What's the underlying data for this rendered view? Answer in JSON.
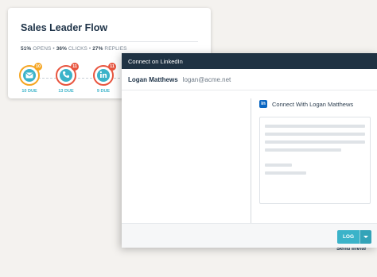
{
  "flow_card": {
    "title": "Sales Leader Flow",
    "stats": {
      "opens_value": "51%",
      "opens_label": "OPENS",
      "clicks_value": "36%",
      "clicks_label": "CLICKS",
      "replies_value": "27%",
      "replies_label": "REPLIES",
      "separator": "•"
    },
    "steps": [
      {
        "icon": "envelope-icon",
        "badge": "10",
        "due_label": "10 DUE"
      },
      {
        "icon": "phone-icon",
        "badge": "11",
        "due_label": "13 DUE"
      },
      {
        "icon": "linkedin-icon",
        "badge": "11",
        "due_label": "9 DUE"
      }
    ]
  },
  "modal": {
    "title": "Connect on LinkedIn",
    "recipient": {
      "name": "Logan Matthews",
      "email": "logan@acme.net"
    },
    "linkedin_badge": "in",
    "linkedin_heading": "Connect With Logan Matthews",
    "send_invite_label": "Send Invite",
    "log_label": "LOG"
  },
  "colors": {
    "header_bg": "#1f3243",
    "accent_teal": "#3bb3c9",
    "badge_red": "#e8553f",
    "ring_orange": "#f5a623",
    "linkedin_blue": "#0a66c2"
  }
}
